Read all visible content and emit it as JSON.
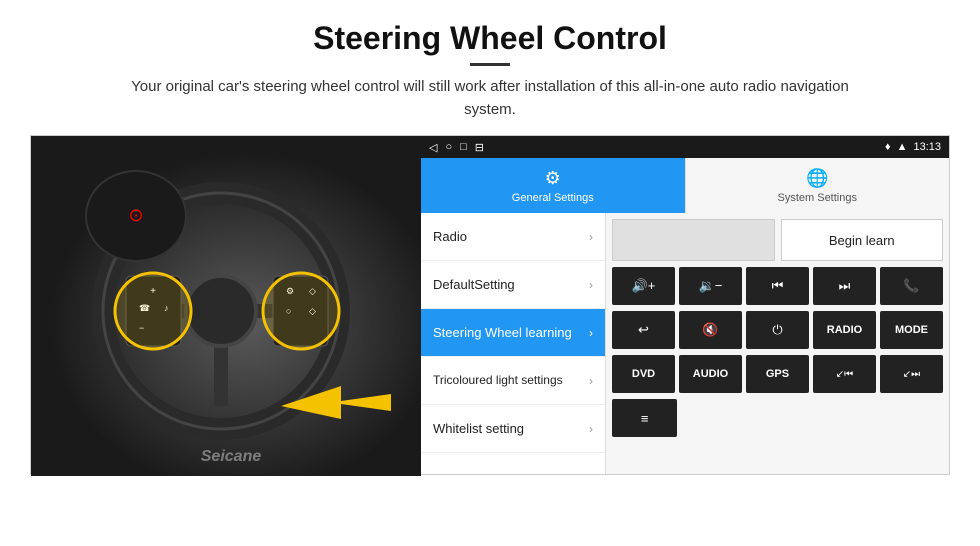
{
  "header": {
    "title": "Steering Wheel Control",
    "divider_visible": true,
    "subtitle": "Your original car's steering wheel control will still work after installation of this all-in-one auto radio navigation system."
  },
  "status_bar": {
    "nav_icons": [
      "◁",
      "○",
      "□",
      "⊟"
    ],
    "right_text": "13:13",
    "wifi_icon": "wifi",
    "signal_icon": "signal"
  },
  "tabs": [
    {
      "id": "general",
      "label": "General Settings",
      "icon": "⚙",
      "active": true
    },
    {
      "id": "system",
      "label": "System Settings",
      "icon": "🌐",
      "active": false
    }
  ],
  "menu_items": [
    {
      "id": "radio",
      "label": "Radio",
      "active": false
    },
    {
      "id": "default",
      "label": "DefaultSetting",
      "active": false
    },
    {
      "id": "steering",
      "label": "Steering Wheel learning",
      "active": true
    },
    {
      "id": "tricoloured",
      "label": "Tricoloured light settings",
      "active": false
    },
    {
      "id": "whitelist",
      "label": "Whitelist setting",
      "active": false
    }
  ],
  "right_panel": {
    "begin_learn_label": "Begin learn",
    "empty_box": "",
    "control_buttons": [
      [
        "↑+",
        "↑−",
        "⏮",
        "⏭",
        "📞"
      ],
      [
        "↩",
        "🔇x",
        "⏻",
        "RADIO",
        "MODE"
      ],
      [
        "DVD",
        "AUDIO",
        "GPS",
        "↙⏮",
        "↙⏭"
      ]
    ],
    "bottom_row": [
      "≡"
    ]
  },
  "watermark": "Seicane"
}
